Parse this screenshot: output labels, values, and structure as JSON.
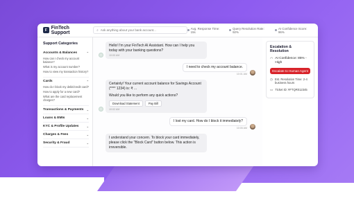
{
  "app": {
    "logo_letter": "F",
    "title": "FinTech Support",
    "search_placeholder": "Ask anything about your bank account...",
    "stats": [
      {
        "label": "Avg. Response Time: 15s"
      },
      {
        "label": "Query Resolution Rate: 92%"
      },
      {
        "label": "AI Confidence Score: 96%"
      }
    ]
  },
  "sidebar": {
    "title": "Support Categories",
    "categories": [
      {
        "label": "Accounts & Balances",
        "items": [
          "How can I check my account balance?",
          "What is my account number?",
          "How to view my transaction history?"
        ]
      },
      {
        "label": "Cards",
        "items": [
          "How do I block my debit/credit card?",
          "How to apply for a new card?",
          "What are the card replacement charges?"
        ]
      },
      {
        "label": "Transactions & Payments",
        "items": []
      },
      {
        "label": "Loans & EMIs",
        "items": []
      },
      {
        "label": "KYC & Profile Updates",
        "items": []
      },
      {
        "label": "Charges & Fees",
        "items": []
      },
      {
        "label": "Security & Fraud",
        "items": []
      }
    ]
  },
  "chat": {
    "m1_text": "Hello! I'm your FinTech AI Assistant. How can I help you today with your banking questions?",
    "m1_time": "10:00 AM",
    "m2_text": "I need to check my account balance.",
    "m2_time": "10:01 AM",
    "m3_text": "Certainly! Your current account balance for Savings Account (**** 1234) is: ₹ ...",
    "m3_text2": "Would you like to perform any quick actions?",
    "m3_btn1": "Download Statement",
    "m3_btn2": "Pay Bill",
    "m3_time": "10:02 AM",
    "m4_text": "I lost my card. How do I block it immediately?",
    "m4_time": "10:05 AM",
    "m5_text": "I understand your concern. To block your card immediately, please click the \"Block Card\" button below. This action is irreversible."
  },
  "panel": {
    "title": "Escalation & Resolution",
    "confidence": "AI Confidence: 85% - High",
    "escalate_label": "Escalate to Human Agent",
    "eta": "Est. Resolution Time: 2-4 business hours",
    "ticket": "Ticket ID: #FTQR012345",
    "escalate_color": "#d8232a"
  }
}
